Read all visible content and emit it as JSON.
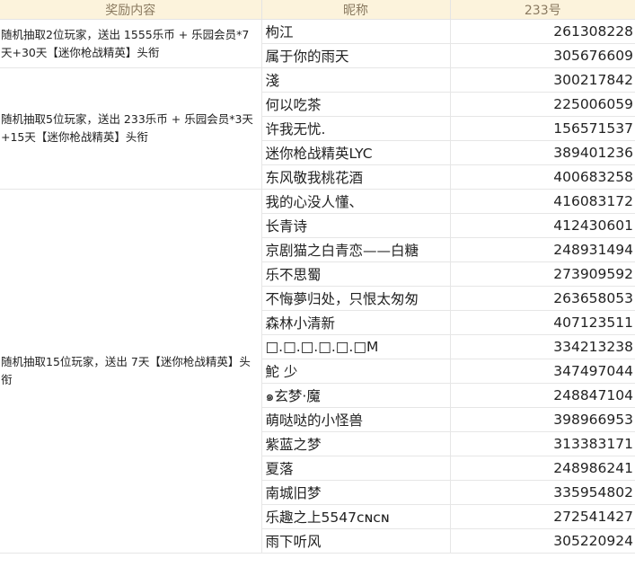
{
  "headers": {
    "reward": "奖励内容",
    "nickname": "昵称",
    "id": "233号"
  },
  "groups": [
    {
      "reward": "随机抽取2位玩家，送出 1555乐币 + 乐园会员*7天+30天【迷你枪战精英】头衔",
      "winners": [
        {
          "nickname": "枸江",
          "id": "261308228"
        },
        {
          "nickname": "属于你的雨天",
          "id": "305676609"
        }
      ]
    },
    {
      "reward": "随机抽取5位玩家，送出 233乐币 + 乐园会员*3天+15天【迷你枪战精英】头衔",
      "winners": [
        {
          "nickname": "淺",
          "id": "300217842"
        },
        {
          "nickname": "何以吃茶",
          "id": "225006059"
        },
        {
          "nickname": "许我无忧.",
          "id": "156571537"
        },
        {
          "nickname": "迷你枪战精英LYC",
          "id": "389401236"
        },
        {
          "nickname": "东风敬我桃花酒",
          "id": "400683258"
        }
      ]
    },
    {
      "reward": "随机抽取15位玩家，送出 7天【迷你枪战精英】头衔",
      "winners": [
        {
          "nickname": "我的心没人懂、",
          "id": "416083172"
        },
        {
          "nickname": "长青诗",
          "id": "412430601"
        },
        {
          "nickname": "京剧猫之白青恋——白糖",
          "id": "248931494"
        },
        {
          "nickname": "乐不思蜀",
          "id": "273909592"
        },
        {
          "nickname": "不悔夢归处，只恨太匆匆",
          "id": "263658053"
        },
        {
          "nickname": "森林小清新",
          "id": "407123511"
        },
        {
          "nickname": "□.□.□.□.□.□M",
          "id": "334213238"
        },
        {
          "nickname": "鮀 少",
          "id": "347497044"
        },
        {
          "nickname": "๑玄梦·魔",
          "id": "248847104"
        },
        {
          "nickname": "萌哒哒的小怪兽",
          "id": "398966953"
        },
        {
          "nickname": "紫蓝之梦",
          "id": "313383171"
        },
        {
          "nickname": "夏落",
          "id": "248986241"
        },
        {
          "nickname": "南城旧梦",
          "id": "335954802"
        },
        {
          "nickname": "乐趣之上5547ᴄɴᴄɴ",
          "id": "272541427"
        },
        {
          "nickname": "雨下听风",
          "id": "305220924"
        }
      ]
    }
  ]
}
